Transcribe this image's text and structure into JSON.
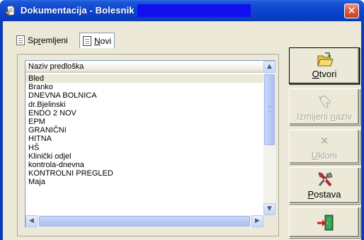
{
  "window": {
    "title": "Dokumentacija - Bolesnik",
    "close_glyph": "✕",
    "icon": "app-document-icon"
  },
  "tabs": [
    {
      "label_prefix": "Sp",
      "label_underlined": "r",
      "label_suffix": "emljeni",
      "icon": "document-icon",
      "selected": false
    },
    {
      "label_prefix": "",
      "label_underlined": "N",
      "label_suffix": "ovi",
      "icon": "document-icon",
      "selected": true
    }
  ],
  "list": {
    "column_header": "Naziv predloška",
    "rows": [
      "Bled",
      "Branko",
      "DNEVNA BOLNICA",
      "dr.Bjelinski",
      "ENDO 2 NOV",
      "EPM",
      "GRANIČNI",
      "HITNA",
      "HŠ",
      "Klinički odjel",
      "kontrola-dnevna",
      "KONTROLNI PREGLED",
      "Maja"
    ],
    "selected_index": 0,
    "scroll_up": "▲",
    "scroll_down": "▼",
    "scroll_left": "◀",
    "scroll_right": "▶"
  },
  "buttons": {
    "otvori": {
      "pre": "",
      "ul": "O",
      "post": "tvori",
      "icon": "open-folder-icon",
      "enabled": true
    },
    "izmjeni": {
      "pre": "Izmijeni ",
      "ul": "n",
      "post": "aziv",
      "icon": "rename-hand-icon",
      "enabled": false
    },
    "ukloni": {
      "pre": "",
      "ul": "U",
      "post": "kloni",
      "icon": "delete-x-icon",
      "enabled": false,
      "glyph": "✕"
    },
    "postava": {
      "pre": "",
      "ul": "P",
      "post": "ostava",
      "icon": "tools-icon",
      "enabled": true
    },
    "exit": {
      "icon": "exit-door-icon",
      "enabled": true
    }
  },
  "colors": {
    "titlebar": "#0a3fc6",
    "title_highlight": "#1010f0",
    "close_button": "#d9593a",
    "dialog_bg": "#ece9d8"
  }
}
